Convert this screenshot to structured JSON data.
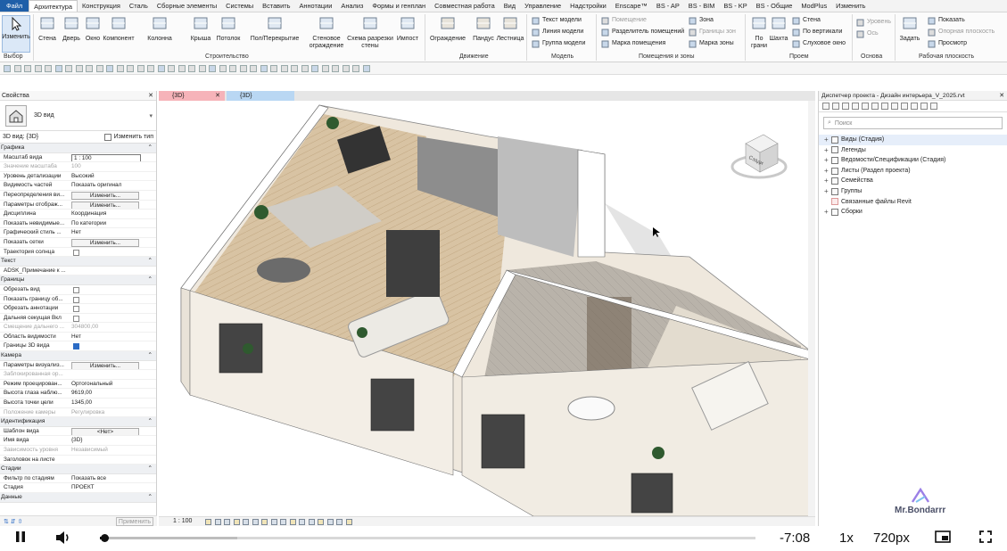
{
  "menu_tabs": [
    "Файл",
    "Архитектура",
    "Конструкция",
    "Сталь",
    "Сборные элементы",
    "Системы",
    "Вставить",
    "Аннотации",
    "Анализ",
    "Формы и генплан",
    "Совместная работа",
    "Вид",
    "Управление",
    "Надстройки",
    "Enscape™",
    "BS - AP",
    "BS - BIM",
    "BS - KP",
    "BS - Общие",
    "ModPlus",
    "Изменить"
  ],
  "ribbon": {
    "modify": "Изменить",
    "build": [
      "Стена",
      "Дверь",
      "Окно",
      "Компонент",
      "Колонна",
      "Крыша",
      "Потолок",
      "Пол/Перекрытие",
      "Стеновое ограждение",
      "Схема разрезки стены",
      "Импост"
    ],
    "circulation": [
      "Ограждение",
      "Пандус",
      "Лестница"
    ],
    "model": [
      "Текст модели",
      "Линия модели",
      "Группа модели"
    ],
    "rooms": [
      "Помещение",
      "Разделитель помещений",
      "Марка помещения",
      "Зона",
      "Границы зон",
      "Марка зоны"
    ],
    "opening": [
      "По грани",
      "Шахта",
      "Стена",
      "По вертикали",
      "Слуховое окно"
    ],
    "datum": [
      "Уровень",
      "Ось"
    ],
    "workplane": [
      "Задать",
      "Показать",
      "Опорная плоскость",
      "Просмотр"
    ],
    "panels": [
      "Выбор",
      "Строительство",
      "Движение",
      "Модель",
      "Помещения и зоны",
      "Проем",
      "Основа",
      "Рабочая плоскость"
    ]
  },
  "properties": {
    "title": "Свойства",
    "type_name": "3D вид",
    "selector": "3D вид: {3D}",
    "edit_type": "Изменить тип",
    "groups": [
      {
        "name": "Графика",
        "rows": [
          {
            "k": "Масштаб вида",
            "v": "1 : 100",
            "kind": "input"
          },
          {
            "k": "Значение масштаба",
            "v": "100",
            "kind": "dis"
          },
          {
            "k": "Уровень детализации",
            "v": "Высокий",
            "kind": "text"
          },
          {
            "k": "Видимость частей",
            "v": "Показать оригинал",
            "kind": "text"
          },
          {
            "k": "Переопределения ви...",
            "v": "Изменить...",
            "kind": "btn"
          },
          {
            "k": "Параметры отображ...",
            "v": "Изменить...",
            "kind": "btn"
          },
          {
            "k": "Дисциплина",
            "v": "Координация",
            "kind": "text"
          },
          {
            "k": "Показать невидимые...",
            "v": "По категории",
            "kind": "text"
          },
          {
            "k": "Графический стиль ...",
            "v": "Нет",
            "kind": "text"
          },
          {
            "k": "Показать сетки",
            "v": "Изменить...",
            "kind": "btn"
          },
          {
            "k": "Траектория солнца",
            "v": "",
            "kind": "cb"
          }
        ]
      },
      {
        "name": "Текст",
        "rows": [
          {
            "k": "ADSK_Примечание к ...",
            "v": "",
            "kind": "text"
          }
        ]
      },
      {
        "name": "Границы",
        "rows": [
          {
            "k": "Обрезать вид",
            "v": "",
            "kind": "cb"
          },
          {
            "k": "Показать границу об...",
            "v": "",
            "kind": "cb"
          },
          {
            "k": "Обрезать аннотации",
            "v": "",
            "kind": "cb"
          },
          {
            "k": "Дальняя секущая Вкл",
            "v": "",
            "kind": "cb"
          },
          {
            "k": "Смещение дальнего ...",
            "v": "304800,00",
            "kind": "dis"
          },
          {
            "k": "Область видимости",
            "v": "Нет",
            "kind": "text"
          },
          {
            "k": "Границы 3D вида",
            "v": "",
            "kind": "cbon"
          }
        ]
      },
      {
        "name": "Камера",
        "rows": [
          {
            "k": "Параметры визуализ...",
            "v": "Изменить...",
            "kind": "btn"
          },
          {
            "k": "Заблокированная ор...",
            "v": "",
            "kind": "dis"
          },
          {
            "k": "Режим проецирован...",
            "v": "Ортогональный",
            "kind": "text"
          },
          {
            "k": "Высота глаза наблю...",
            "v": "9619,00",
            "kind": "text"
          },
          {
            "k": "Высота точки цели",
            "v": "1345,00",
            "kind": "text"
          },
          {
            "k": "Положение камеры",
            "v": "Регулировка",
            "kind": "dis"
          }
        ]
      },
      {
        "name": "Идентификация",
        "rows": [
          {
            "k": "Шаблон вида",
            "v": "<Нет>",
            "kind": "btn"
          },
          {
            "k": "Имя вида",
            "v": "{3D}",
            "kind": "text"
          },
          {
            "k": "Зависимость уровня",
            "v": "Независимый",
            "kind": "dis"
          },
          {
            "k": "Заголовок на листе",
            "v": "",
            "kind": "text"
          }
        ]
      },
      {
        "name": "Стадии",
        "rows": [
          {
            "k": "Фильтр по стадиям",
            "v": "Показать все",
            "kind": "text"
          },
          {
            "k": "Стадия",
            "v": "ПРОЕКТ",
            "kind": "text"
          }
        ]
      },
      {
        "name": "Данные",
        "rows": []
      }
    ],
    "apply": "Применить"
  },
  "view": {
    "tabs": [
      "{3D}",
      "{3D}"
    ],
    "scale": "1 : 100",
    "viewcube_label": "Сзади"
  },
  "browser": {
    "title": "Диспетчер проекта - Дизайн интерьера_V_2025.rvt",
    "search": "Поиск",
    "items": [
      "Виды (Стадия)",
      "Легенды",
      "Ведомости/Спецификации (Стадия)",
      "Листы (Раздел проекта)",
      "Семейства",
      "Группы",
      "Связанные файлы Revit",
      "Сборки"
    ],
    "watermark": "Mr.Bondarrr"
  },
  "player": {
    "time": "-7:08",
    "speed": "1x",
    "quality": "720px",
    "progress": 0.005,
    "buffered": 0.21
  },
  "colors": {
    "accent": "#1f5fa8",
    "tab_active": "#f6b3b9",
    "tab_second": "#b9d7f3"
  }
}
